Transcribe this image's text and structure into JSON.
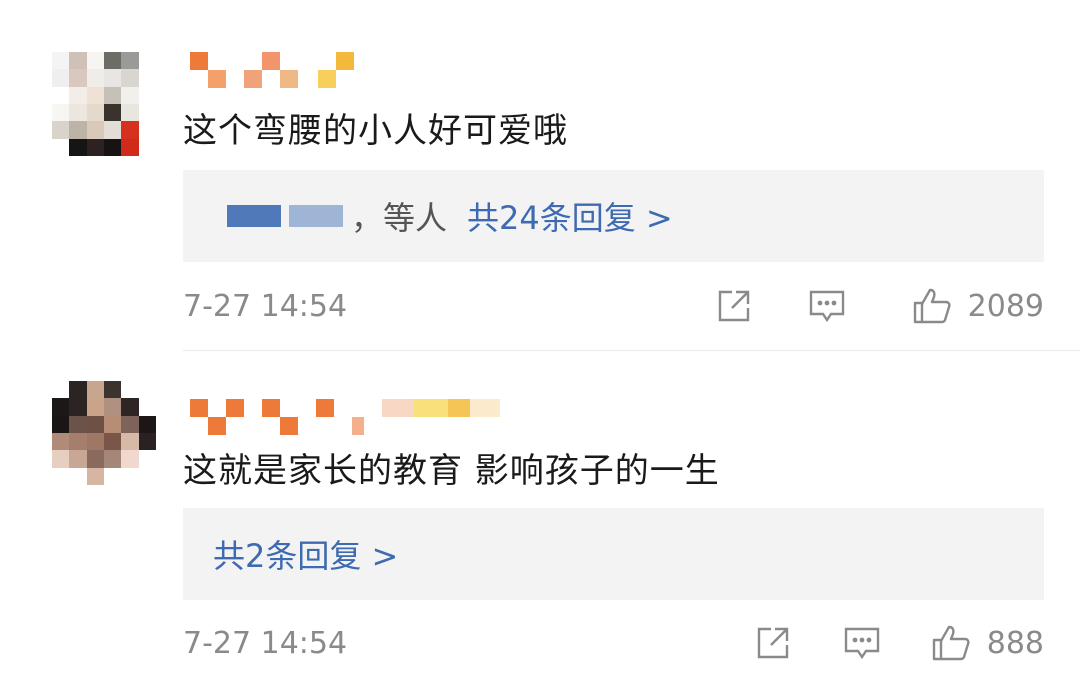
{
  "comments": [
    {
      "text": "这个弯腰的小人好可爱哦",
      "reply_prefix": "，等人",
      "reply_link": "共24条回复 >",
      "time": "7-27 14:54",
      "likes": "2089"
    },
    {
      "text": "这就是家长的教育 影响孩子的一生",
      "reply_link": "共2条回复 >",
      "time": "7-27 14:54",
      "likes": "888"
    }
  ],
  "icons": {
    "share": "share-icon",
    "comment": "comment-icon",
    "like": "thumbs-up-icon"
  },
  "colors": {
    "link": "#3d6ab0",
    "meta": "#8a8a8a",
    "reply_bg": "#f3f3f3"
  }
}
